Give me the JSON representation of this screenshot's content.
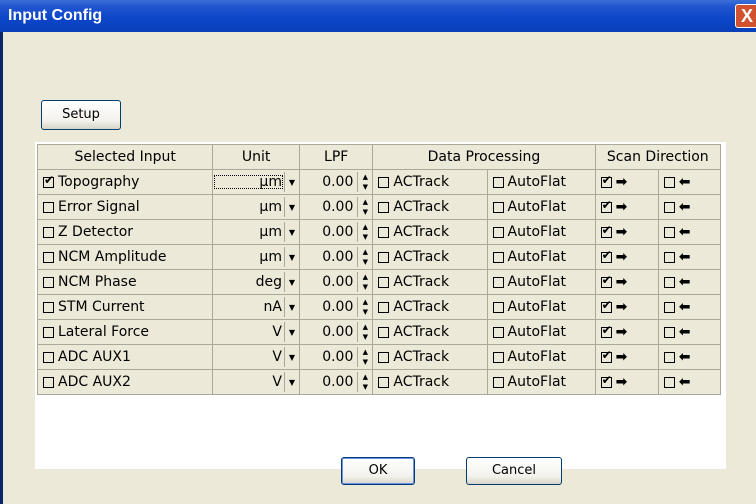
{
  "window": {
    "title": "Input Config",
    "close_label": "X"
  },
  "buttons": {
    "setup": "Setup",
    "ok": "OK",
    "cancel": "Cancel"
  },
  "table": {
    "headers": {
      "selected_input": "Selected Input",
      "unit": "Unit",
      "lpf": "LPF",
      "data_processing": "Data Processing",
      "scan_direction": "Scan Direction"
    },
    "option_labels": {
      "actrack": "ACTrack",
      "autoflat": "AutoFlat"
    },
    "rows": [
      {
        "name": "Topography",
        "selected": true,
        "unit": "µm",
        "lpf": "0.00",
        "actrack": false,
        "autoflat": false,
        "forward": true,
        "backward": false
      },
      {
        "name": "Error Signal",
        "selected": false,
        "unit": "µm",
        "lpf": "0.00",
        "actrack": false,
        "autoflat": false,
        "forward": true,
        "backward": false
      },
      {
        "name": "Z Detector",
        "selected": false,
        "unit": "µm",
        "lpf": "0.00",
        "actrack": false,
        "autoflat": false,
        "forward": true,
        "backward": false
      },
      {
        "name": "NCM Amplitude",
        "selected": false,
        "unit": "µm",
        "lpf": "0.00",
        "actrack": false,
        "autoflat": false,
        "forward": true,
        "backward": false
      },
      {
        "name": "NCM Phase",
        "selected": false,
        "unit": "deg",
        "lpf": "0.00",
        "actrack": false,
        "autoflat": false,
        "forward": true,
        "backward": false
      },
      {
        "name": "STM Current",
        "selected": false,
        "unit": "nA",
        "lpf": "0.00",
        "actrack": false,
        "autoflat": false,
        "forward": true,
        "backward": false
      },
      {
        "name": "Lateral Force",
        "selected": false,
        "unit": "V",
        "lpf": "0.00",
        "actrack": false,
        "autoflat": false,
        "forward": true,
        "backward": false
      },
      {
        "name": "ADC AUX1",
        "selected": false,
        "unit": "V",
        "lpf": "0.00",
        "actrack": false,
        "autoflat": false,
        "forward": true,
        "backward": false
      },
      {
        "name": "ADC AUX2",
        "selected": false,
        "unit": "V",
        "lpf": "0.00",
        "actrack": false,
        "autoflat": false,
        "forward": true,
        "backward": false
      }
    ]
  },
  "icons": {
    "forward": "right-arrow-icon",
    "backward": "left-arrow-icon",
    "dropdown": "chevron-down-icon",
    "spinner": "spinner-icon"
  },
  "colors": {
    "title_bar": "#0a46c8",
    "dialog_bg": "#ece9d8",
    "close_button": "#d2522f"
  }
}
